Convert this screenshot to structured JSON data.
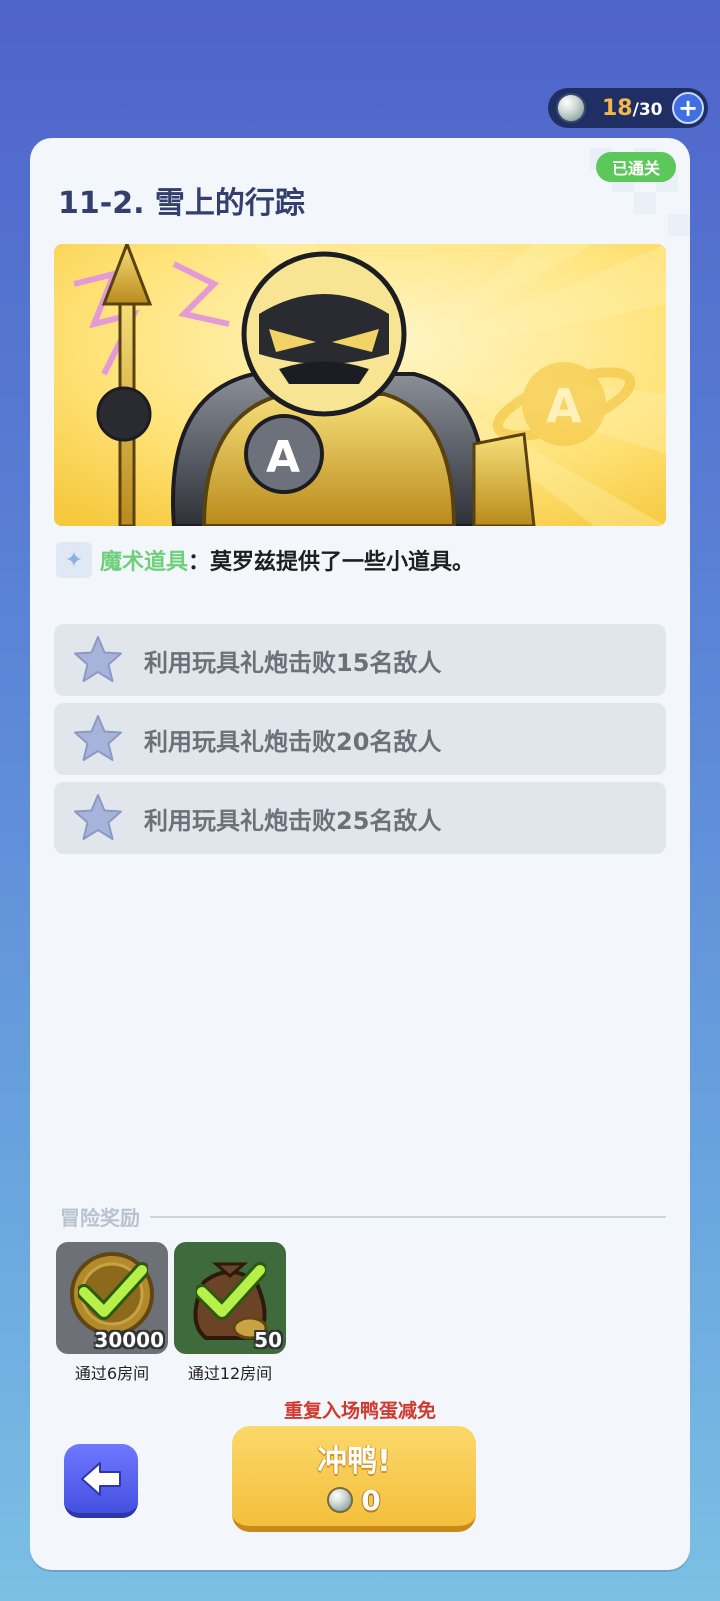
{
  "currency": {
    "current": "18",
    "max": "/30",
    "icon": "duck-egg-icon"
  },
  "level": {
    "status": "已通关",
    "title": "11-2. 雪上的行踪",
    "banner_icon": "armored-knight-illustration",
    "description": {
      "tag": "魔术道具",
      "separator": "：",
      "text": "莫罗兹提供了一些小道具。"
    }
  },
  "objectives": [
    {
      "label": "利用玩具礼炮击败15名敌人"
    },
    {
      "label": "利用玩具礼炮击败20名敌人"
    },
    {
      "label": "利用玩具礼炮击败25名敌人"
    }
  ],
  "rewards": {
    "title": "冒险奖励",
    "items": [
      {
        "amount": "30000",
        "caption": "通过6房间",
        "icon": "gold-coin-icon"
      },
      {
        "amount": "50",
        "caption": "通过12房间",
        "icon": "money-bag-icon"
      }
    ]
  },
  "actions": {
    "waiver_text": "重复入场鸭蛋减免",
    "go_label": "冲鸭!",
    "go_cost": "0"
  },
  "colors": {
    "accent_green": "#5cc85a",
    "tag_green": "#6ed07a",
    "button_yellow": "#f4bf3c",
    "button_blue": "#4450e0",
    "warning_red": "#d03a2e"
  }
}
